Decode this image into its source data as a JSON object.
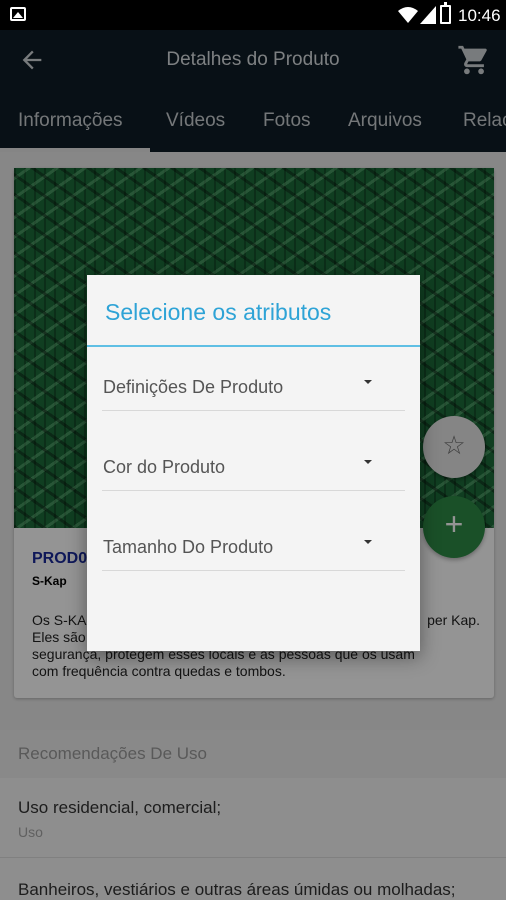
{
  "status_bar": {
    "time": "10:46"
  },
  "app_bar": {
    "title": "Detalhes do Produto"
  },
  "tabs": [
    {
      "label": "Informações"
    },
    {
      "label": "Vídeos"
    },
    {
      "label": "Fotos"
    },
    {
      "label": "Arquivos"
    },
    {
      "label": "Relac"
    }
  ],
  "product": {
    "title": "PROD0",
    "brand": "S-Kap",
    "description_line1": "Os S-KA",
    "description_line1_tail": "per Kap.",
    "description_line2": "Eles são",
    "description_line3": "segurança, protegem esses locais e as pessoas que os usam",
    "description_line4": "com frequência contra quedas e tombos."
  },
  "recommendations": {
    "header": "Recomendações De Uso",
    "items": [
      {
        "main": "Uso residencial, comercial;",
        "sub": "Uso"
      },
      {
        "main": "Banheiros, vestiários e outras áreas úmidas ou molhadas;"
      }
    ]
  },
  "dialog": {
    "title": "Selecione os atributos",
    "spinners": [
      {
        "label": "Definições De Produto"
      },
      {
        "label": "Cor do Produto"
      },
      {
        "label": "Tamanho Do Produto"
      }
    ]
  },
  "colors": {
    "app_bar": "#0f1d26",
    "dialog_accent": "#2ea3d6",
    "fab_add": "#2e8b46",
    "product_title": "#1a2a9a"
  },
  "icons": {
    "back": "arrow-left-icon",
    "cart": "cart-icon",
    "star": "star-outline-icon",
    "add": "plus-icon"
  }
}
